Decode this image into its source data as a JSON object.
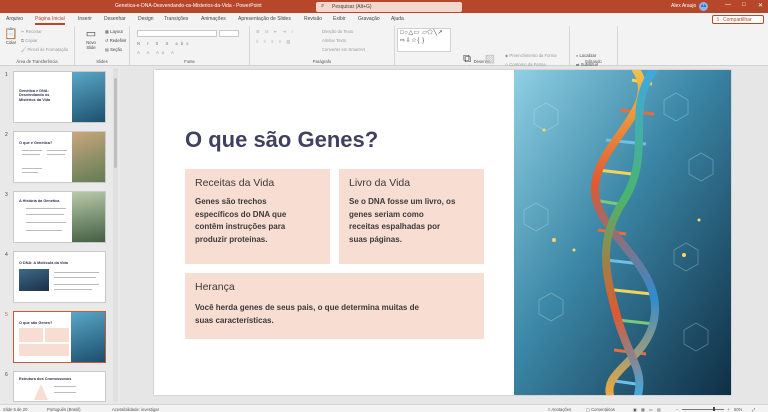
{
  "titlebar": {
    "doc_title": "Genetica-e-DNA-Desvendando-os-Misterios-da-Vida  -  PowerPoint",
    "search_placeholder": "Pesquisar (Alt+G)",
    "user_name": "Alex Araujo",
    "user_initials": "AA",
    "minimize": "—",
    "maximize": "□",
    "close": "✕"
  },
  "tabs": [
    "Arquivo",
    "Página Inicial",
    "Inserir",
    "Desenhar",
    "Design",
    "Transições",
    "Animações",
    "Apresentação de Slides",
    "Revisão",
    "Exibir",
    "Gravação",
    "Ajuda"
  ],
  "active_tab": "Página Inicial",
  "share_label": "Compartilhar",
  "ribbon": {
    "groups": {
      "clipboard": "Área de Transferência",
      "slides": "Slides",
      "font": "Fonte",
      "paragraph": "Parágrafo",
      "drawing": "Desenho",
      "editing": "Editando"
    },
    "clipboard": {
      "paste": "Colar",
      "cut": "Recortar",
      "copy": "Copiar",
      "format_painter": "Pincel de Formatação"
    },
    "slides": {
      "new_slide": "Novo Slide",
      "layout": "Layout",
      "reset": "Redefinir",
      "section": "Seção"
    },
    "paragraph": {
      "text_direction": "Direção do Texto",
      "align_text": "Alinhar Texto",
      "smartart": "Converter em SmartArt"
    },
    "drawing": {
      "shapes_glyphs": "□○△▭ ▱⬠╲↗ ⇨⇩☆{ }",
      "arrange": "Organizar",
      "quick_styles": "Estilos Rápidos",
      "fill": "Preenchimento da Forma",
      "outline": "Contorno da Forma",
      "effects": "Efeitos de Forma"
    },
    "editing": {
      "find": "Localizar",
      "replace": "Substituir",
      "select": "Selecionar"
    }
  },
  "thumbnails": [
    {
      "num": "1",
      "title": "Genética e DNA: Desvendando os Mistérios da Vida"
    },
    {
      "num": "2",
      "title": "O que é Genética?"
    },
    {
      "num": "3",
      "title": "A História da Genética"
    },
    {
      "num": "4",
      "title": "O DNA: A Molécula da Vida"
    },
    {
      "num": "5",
      "title": "O que são Genes?"
    },
    {
      "num": "6",
      "title": "Estrutura dos Cromossomos"
    }
  ],
  "slide": {
    "title": "O que são Genes?",
    "cards": [
      {
        "heading": "Receitas da Vida",
        "body": [
          "Genes são trechos",
          "específicos do DNA que",
          "contêm instruções para",
          "produzir proteínas."
        ]
      },
      {
        "heading": "Livro da Vida",
        "body": [
          "Se o DNA fosse um livro, os",
          "genes seriam como",
          "receitas espalhadas por",
          "suas páginas."
        ]
      },
      {
        "heading": "Herança",
        "body": [
          "Você herda genes de seus pais, o que determina muitas de",
          "suas características."
        ]
      }
    ]
  },
  "statusbar": {
    "slide_info": "Slide 5 de 20",
    "language": "Português (Brasil)",
    "accessibility": "Acessibilidade: investigar",
    "notes": "Anotações",
    "comments": "Comentários",
    "zoom": "50%"
  },
  "colors": {
    "accent": "#b7472a",
    "card_bg": "#f8ddd3",
    "title": "#404060"
  }
}
